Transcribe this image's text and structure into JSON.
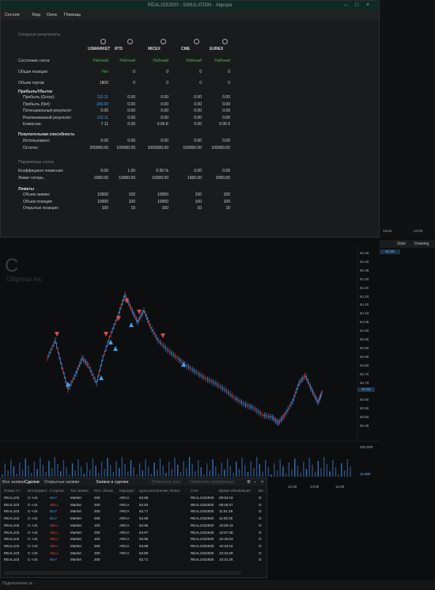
{
  "window": {
    "title": "REAL1032930 - SIMULATION - Аврора",
    "menu": [
      "Сессия",
      "Вид",
      "Окна",
      "Помощь"
    ]
  },
  "summary": {
    "section_title": "Сводные результаты",
    "columns": [
      "USMARKET",
      "RTS",
      "MICEX",
      "CME",
      "EUREX"
    ],
    "rows": [
      {
        "label": "Состояние счета:",
        "values": [
          "Рабочий",
          "Рабочий",
          "Рабочий",
          "Рабочий",
          "Рабочий"
        ],
        "green": true
      },
      {
        "label": "Общая позиция:",
        "values": [
          "Нет",
          "0",
          "0",
          "0",
          "0"
        ],
        "first_green": true
      },
      {
        "label": "Объем торгов:",
        "values": [
          "1800",
          "0",
          "0",
          "0",
          "0"
        ]
      }
    ],
    "pnl_title": "Прибыль/Убыток",
    "pnl_rows": [
      {
        "label": "Прибыль (Gross):",
        "values": [
          "113.11",
          "0.00",
          "0.00",
          "0.00",
          "0.00"
        ],
        "first_blue": true
      },
      {
        "label": "Прибыль (Net):",
        "values": [
          "106.00",
          "0.00",
          "0.00",
          "0.00",
          "0.00"
        ],
        "first_blue": true
      },
      {
        "label": "Потенциальный результат:",
        "values": [
          "0.00",
          "0.00",
          "0.00",
          "0.00",
          "0.00"
        ]
      },
      {
        "label": "Реализованный результат:",
        "values": [
          "113.11",
          "0.00",
          "0.00",
          "0.00",
          "0.00"
        ],
        "first_blue": true
      },
      {
        "label": "Комиссия:",
        "values": [
          "7.11",
          "0.00",
          "0.00 ₽",
          "0.00",
          "0.00 €"
        ]
      }
    ],
    "buying_title": "Покупательная способность",
    "buying_rows": [
      {
        "label": "Использовано:",
        "values": [
          "0.00",
          "0.00",
          "0.00",
          "0.00",
          "0.00"
        ]
      },
      {
        "label": "Остаток:",
        "values": [
          "200000.00",
          "100000.00",
          "1000000.00",
          "100000.00",
          "100000.00"
        ]
      }
    ],
    "params_title": "Параметры счета",
    "params_rows": [
      {
        "label": "Коэффициент комиссии:",
        "values": [
          "0.00",
          "1.00",
          "0.00 %",
          "0.00",
          "0.00"
        ]
      },
      {
        "label": "Лимит потерь:",
        "values": [
          "2000.00",
          "10000.00",
          "10000.00",
          "1000.00",
          "2000.00"
        ]
      }
    ],
    "limits_title": "Лимиты",
    "limits_rows": [
      {
        "label": "Объем заявки:",
        "values": [
          "10000",
          "100",
          "10000",
          "100",
          "100"
        ]
      },
      {
        "label": "Объем позиции:",
        "values": [
          "10000",
          "100",
          "10000",
          "100",
          "100"
        ]
      },
      {
        "label": "Открытые позиции:",
        "values": [
          "100",
          "10",
          "100",
          "10",
          "10"
        ]
      }
    ]
  },
  "chart": {
    "symbol": "C",
    "symbol_name": "Citigroup Inc",
    "price_ticks": [
      "64.45",
      "64.40",
      "64.35",
      "64.30",
      "64.25",
      "64.20",
      "64.15",
      "64.10",
      "64.05",
      "64.00",
      "63.95",
      "63.90",
      "63.85",
      "63.80",
      "63.75",
      "63.70",
      "63.65",
      "63.60",
      "63.55",
      "63.50",
      "63.45"
    ],
    "last_price": "63.60",
    "right_price": "64.05",
    "volume_tick": "200,000",
    "volume_last": "11,680",
    "right_toolbar": [
      "Style",
      "Drawing"
    ],
    "time_labels": [
      "13:51",
      "14:00",
      "13:30",
      "14:00",
      "14:30",
      "13:19",
      "14:15",
      "13:30",
      "13:45"
    ]
  },
  "orders": {
    "panel_title": "Заявки и сделки",
    "tabs": [
      "Все заявки",
      "Сделки",
      "Открытые заявки"
    ],
    "active_tab": "Сделки",
    "filter_buttons": [
      "Отменить все",
      "Отменить выбранные"
    ],
    "columns": [
      "Номер сч",
      "Инструмент",
      "Сторона",
      "Тип заявки",
      "Исп. объем",
      "Маршрут",
      "Цена исполнения",
      "Флаги",
      "Счет",
      "Время обновления",
      "Би"
    ],
    "rows": [
      [
        "REAL103",
        "C--US",
        "BUY",
        "Market",
        "200",
        "ARCA",
        "63.88",
        "",
        "REAL1032930",
        "09:53:19",
        "O"
      ],
      [
        "REAL103",
        "C--US",
        "SELL",
        "Market",
        "200",
        "ARCA",
        "63.83",
        "",
        "REAL1032930",
        "09:46:27",
        "O"
      ],
      [
        "REAL103",
        "C--US",
        "BUY",
        "Market",
        "200",
        "ARCA",
        "63.77",
        "",
        "REAL1032930",
        "11:51:28",
        "O"
      ],
      [
        "REAL103",
        "C--US",
        "BUY",
        "Market",
        "200",
        "ARCA",
        "63.98",
        "",
        "REAL1032930",
        "11:02:08",
        "O"
      ],
      [
        "REAL103",
        "C--US",
        "SELL",
        "Market",
        "100",
        "ARCA",
        "63.95",
        "",
        "REAL1032930",
        "10:59:43",
        "O"
      ],
      [
        "REAL103",
        "C--US",
        "SELL",
        "Market",
        "200",
        "ARCA",
        "63.97",
        "",
        "REAL1032930",
        "10:57:38",
        "O"
      ],
      [
        "REAL103",
        "C--US",
        "SELL",
        "Market",
        "100",
        "ARCA",
        "63.95",
        "",
        "REAL1032930",
        "10:45:53",
        "O"
      ],
      [
        "REAL103",
        "C--US",
        "SELL",
        "Market",
        "200",
        "ARCA",
        "63.88",
        "",
        "REAL1032930",
        "10:43:16",
        "O"
      ],
      [
        "REAL103",
        "C--US",
        "SELL",
        "Market",
        "200",
        "ARCA",
        "63.80",
        "",
        "REAL1032930",
        "10:34:29",
        "O"
      ],
      [
        "REAL103",
        "C--US",
        "BUY",
        "Market",
        "200",
        "",
        "63.71",
        "",
        "REAL1032930",
        "10:31:26",
        "O"
      ]
    ]
  },
  "status": {
    "text": "Подключение ок"
  }
}
